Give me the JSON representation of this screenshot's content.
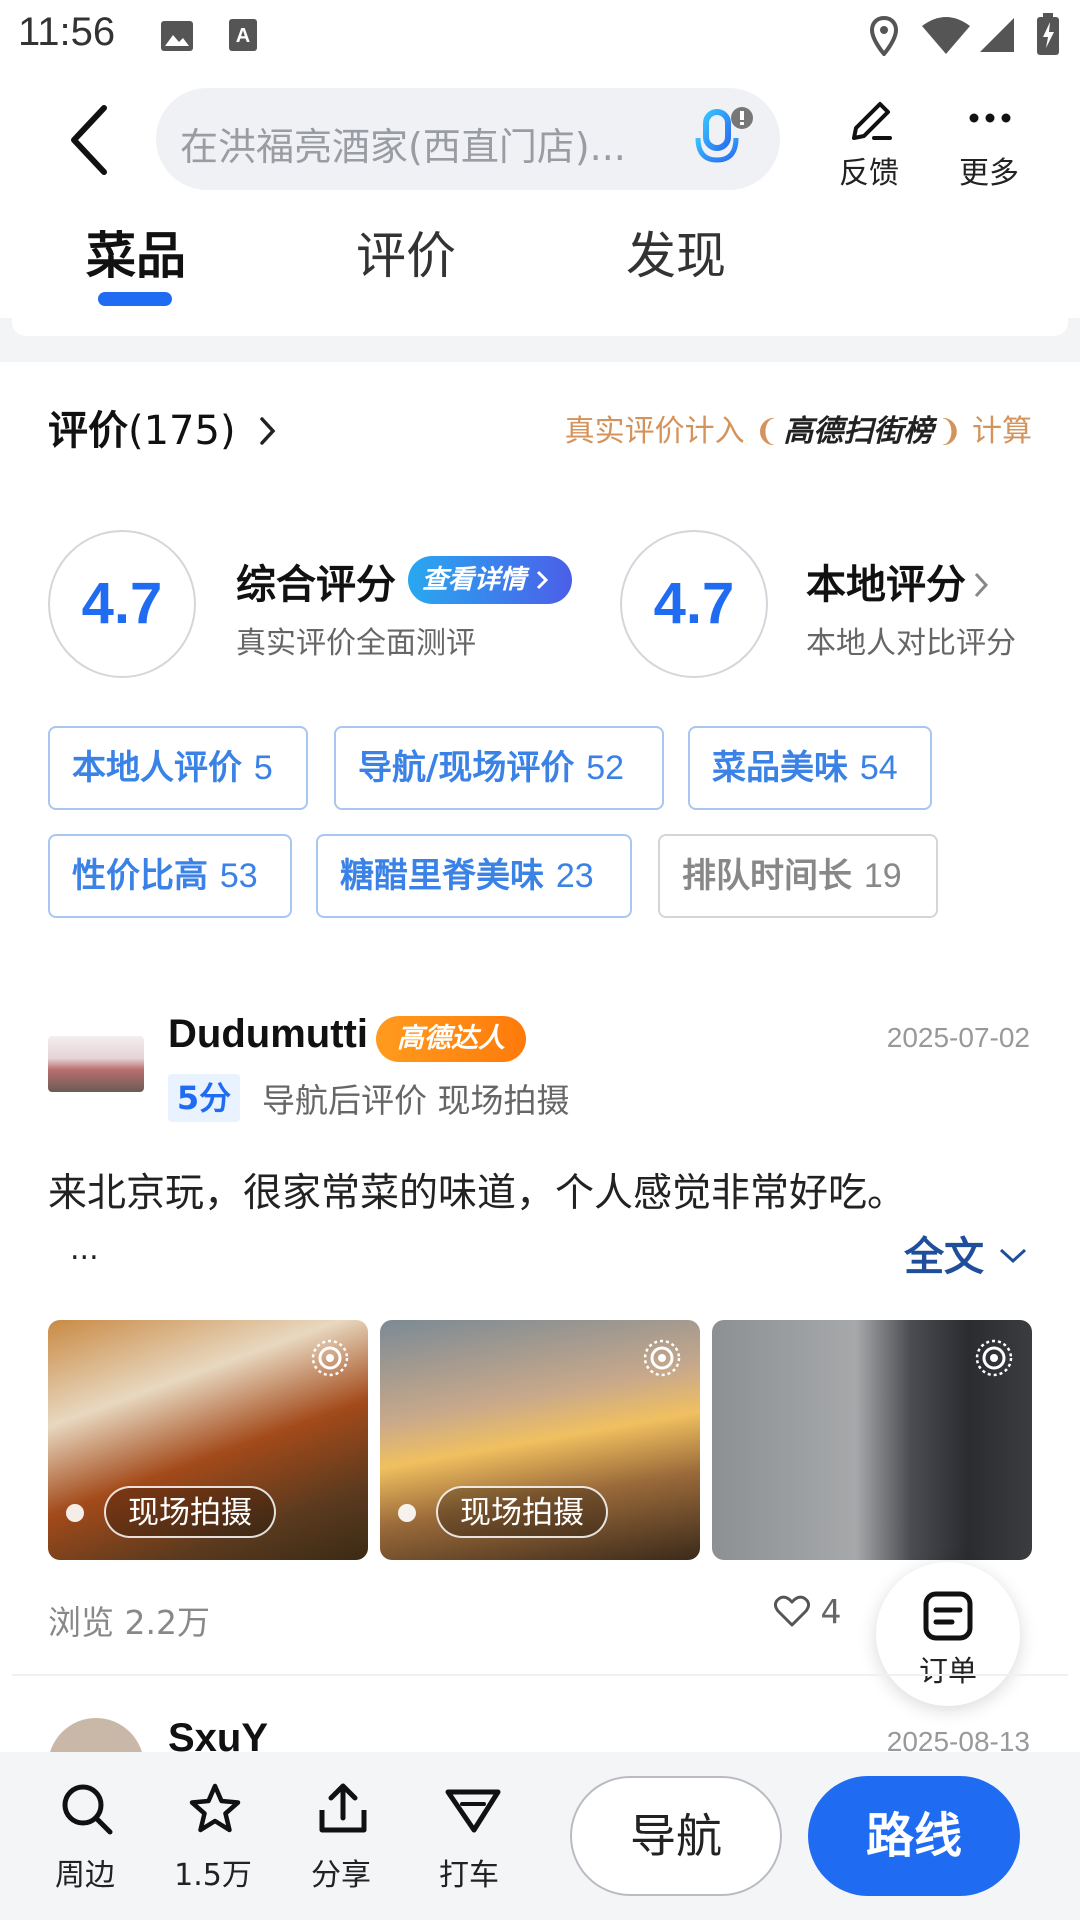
{
  "status_bar": {
    "time": "11:56"
  },
  "header": {
    "search_placeholder": "在洪福亮酒家(西直门店)...",
    "feedback_label": "反馈",
    "more_label": "更多"
  },
  "tabs": [
    {
      "label": "菜品",
      "active": true
    },
    {
      "label": "评价",
      "active": false
    },
    {
      "label": "发现",
      "active": false
    }
  ],
  "reviews": {
    "title": "评价",
    "count": "(175)",
    "rank_note_prefix": "真实评价计入",
    "rank_brand": "高德扫街榜",
    "rank_note_suffix": "计算",
    "overall": {
      "score": "4.7",
      "title": "综合评分",
      "detail_label": "查看详情",
      "subtitle": "真实评价全面测评"
    },
    "local": {
      "score": "4.7",
      "title": "本地评分",
      "subtitle": "本地人对比评分"
    },
    "tags": [
      {
        "label": "本地人评价",
        "count": "5"
      },
      {
        "label": "导航/现场评价",
        "count": "52"
      },
      {
        "label": "菜品美味",
        "count": "54"
      },
      {
        "label": "性价比高",
        "count": "53"
      },
      {
        "label": "糖醋里脊美味",
        "count": "23"
      },
      {
        "label": "排队时间长",
        "count": "19"
      }
    ]
  },
  "review_1": {
    "username": "Dudumutti",
    "badge": "高德达人",
    "date": "2025-07-02",
    "score": "5分",
    "meta": "导航后评价  现场拍摄",
    "text": "来北京玩，很家常菜的味道，个人感觉非常好吃。",
    "ellipsis": "...",
    "full_text_label": "全文",
    "photo_labels": [
      "现场拍摄",
      "现场拍摄"
    ],
    "views": "浏览 2.2万",
    "likes": "4"
  },
  "review_2": {
    "username": "SxuY",
    "date": "2025-08-13"
  },
  "order_fab": {
    "label": "订单"
  },
  "bottom_bar": {
    "nearby": "周边",
    "favorites": "1.5万",
    "share": "分享",
    "taxi": "打车",
    "navigate": "导航",
    "route": "路线"
  },
  "colors": {
    "accent": "#1f6cf3",
    "badge_orange": "#ff8a12",
    "tag_blue": "#3b82e6"
  }
}
